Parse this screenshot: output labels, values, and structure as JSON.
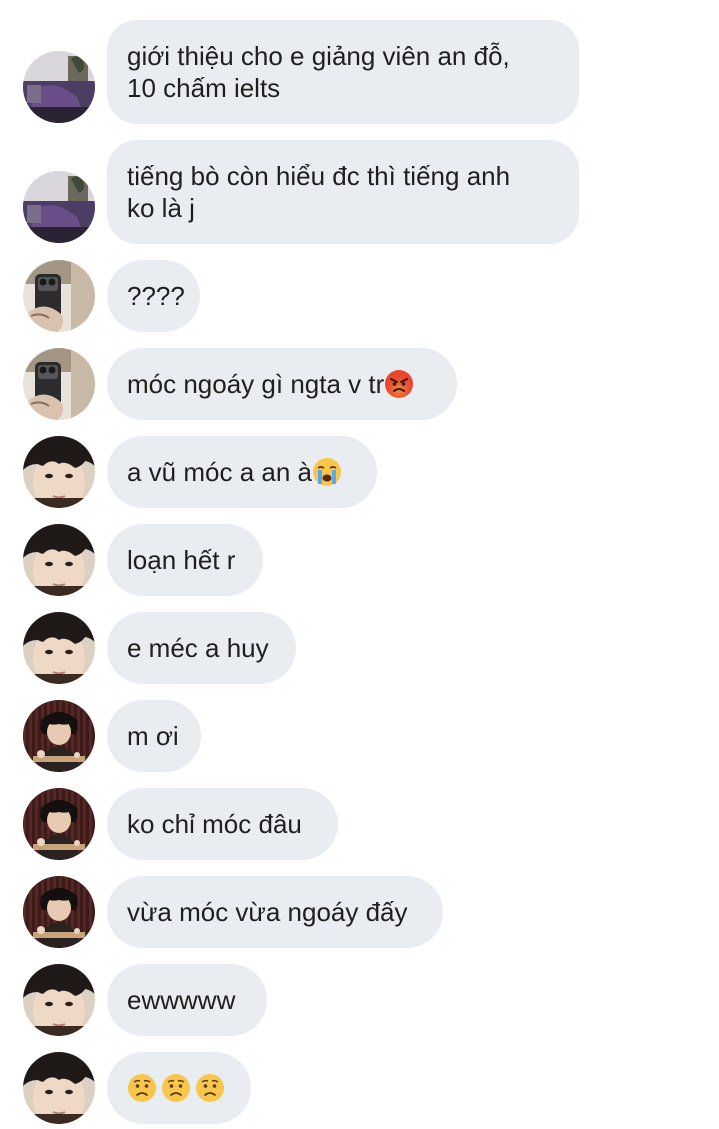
{
  "messages": [
    {
      "sender": "user-a",
      "text": "giới thiệu cho e giảng viên an đỗ,",
      "text2": "10 chấm ielts"
    },
    {
      "sender": "user-a",
      "text": "tiếng bò còn hiểu đc thì tiếng anh",
      "text2": "ko là j"
    },
    {
      "sender": "user-b",
      "text": "????"
    },
    {
      "sender": "user-b",
      "text": "móc ngoáy gì ngta v tr",
      "emoji": [
        "angry-face-icon"
      ]
    },
    {
      "sender": "user-c",
      "text": "a vũ móc a an à",
      "emoji": [
        "loudly-crying-face-icon"
      ]
    },
    {
      "sender": "user-c",
      "text": "loạn hết r"
    },
    {
      "sender": "user-c",
      "text": "e méc a huy"
    },
    {
      "sender": "user-d",
      "text": "m ơi"
    },
    {
      "sender": "user-d",
      "text": "ko chỉ móc đâu"
    },
    {
      "sender": "user-d",
      "text": "vừa móc vừa ngoáy đấy"
    },
    {
      "sender": "user-c",
      "text": "ewwwww"
    },
    {
      "sender": "user-c",
      "text": "",
      "emoji": [
        "worried-face-icon",
        "worried-face-icon",
        "worried-face-icon"
      ]
    }
  ],
  "colors": {
    "bubble_bg": "#e9ecf0",
    "text": "#1f1f1f",
    "background": "#ffffff"
  }
}
